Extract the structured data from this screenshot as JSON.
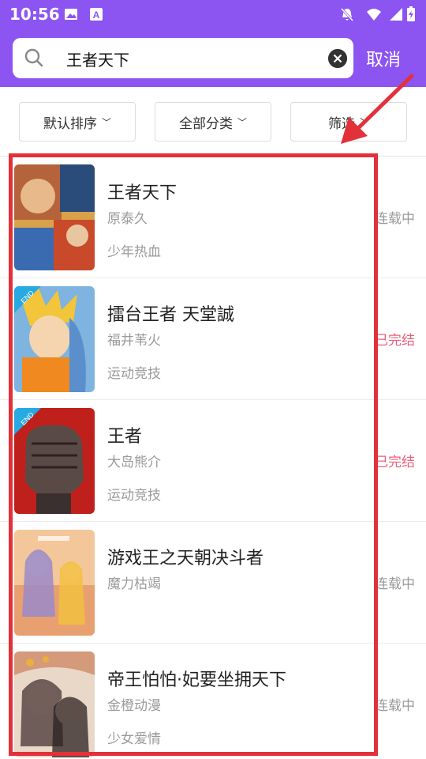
{
  "status_bar": {
    "time": "10:56"
  },
  "search": {
    "query": "王者天下",
    "cancel_label": "取消"
  },
  "filters": [
    {
      "label": "默认排序"
    },
    {
      "label": "全部分类"
    },
    {
      "label": "筛选"
    }
  ],
  "results": [
    {
      "title": "王者天下",
      "author": "原泰久",
      "genre": "少年热血",
      "status": "连载中",
      "badge": ""
    },
    {
      "title": "擂台王者 天堂誠",
      "author": "福井苇火",
      "genre": "运动竞技",
      "status": "已完结",
      "badge": "END"
    },
    {
      "title": "王者",
      "author": "大岛熊介",
      "genre": "运动竞技",
      "status": "已完结",
      "badge": "END"
    },
    {
      "title": "游戏王之天朝决斗者",
      "author": "魔力枯竭",
      "genre": "",
      "status": "连载中",
      "badge": ""
    },
    {
      "title": "帝王怕怕·妃要坐拥天下",
      "author": "金橙动漫",
      "genre": "少女爱情",
      "status": "连载中",
      "badge": ""
    }
  ],
  "colors": {
    "accent": "#8c54f0",
    "ongoing": "#9a9a9a",
    "finished": "#e8607a",
    "highlight": "#e3313a"
  }
}
